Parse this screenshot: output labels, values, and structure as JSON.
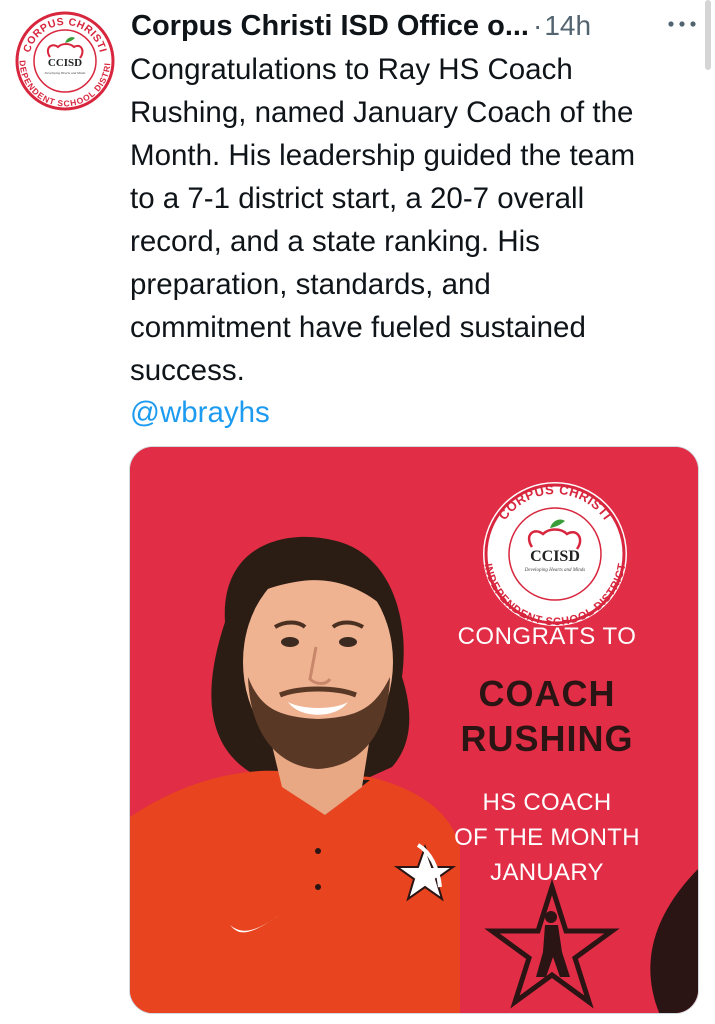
{
  "tweet": {
    "author_name": "Corpus Christi ISD Office o...",
    "separator": "·",
    "timestamp": "14h",
    "text": "Congratulations to Ray HS Coach\nRushing, named January Coach of the\nMonth. His leadership guided the team\nto a 7-1 district start, a 20-7 overall\nrecord, and a state ranking. His\npreparation, standards, and\ncommitment have fueled sustained\nsuccess.",
    "mention": "@wbrayhs"
  },
  "logo": {
    "arc_top": "CORPUS CHRISTI",
    "arc_bottom": "INDEPENDENT SCHOOL DISTRICT",
    "abbr": "CCISD",
    "tagline": "Developing Hearts and Minds"
  },
  "graphic": {
    "line1": "CONGRATS TO",
    "line2": "COACH",
    "line3": "RUSHING",
    "line4": "HS COACH",
    "line5": "OF THE MONTH",
    "line6": "JANUARY"
  },
  "colors": {
    "media_bg": "#e12d45",
    "logo_red": "#d7263d",
    "mention_blue": "#1d9bf0",
    "name_dark": "#2b1414"
  },
  "icons": {
    "more": "more-horizontal-icon",
    "apple": "apple-icon",
    "star": "star-icon",
    "swoosh": "swoosh-logo"
  }
}
